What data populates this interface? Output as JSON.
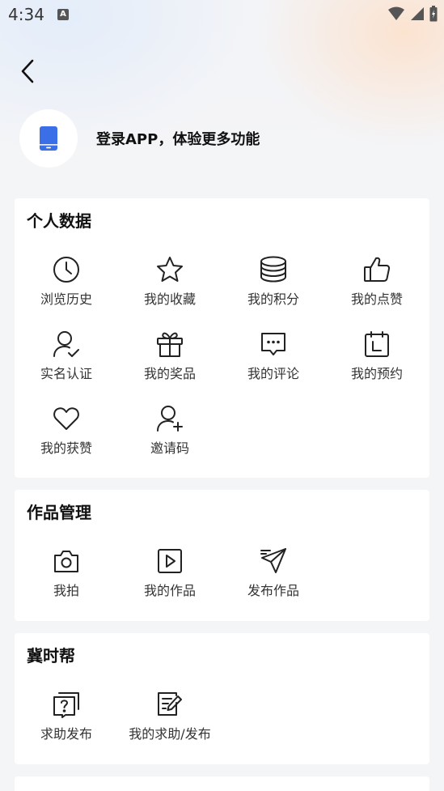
{
  "status_bar": {
    "time": "4:34",
    "notice_badge": "A"
  },
  "login": {
    "text": "登录APP，体验更多功能"
  },
  "sections": [
    {
      "title": "个人数据",
      "items": [
        {
          "label": "浏览历史",
          "icon": "clock-icon"
        },
        {
          "label": "我的收藏",
          "icon": "star-icon"
        },
        {
          "label": "我的积分",
          "icon": "coins-icon"
        },
        {
          "label": "我的点赞",
          "icon": "thumbs-up-icon"
        },
        {
          "label": "实名认证",
          "icon": "user-check-icon"
        },
        {
          "label": "我的奖品",
          "icon": "gift-icon"
        },
        {
          "label": "我的评论",
          "icon": "comment-icon"
        },
        {
          "label": "我的预约",
          "icon": "calendar-icon"
        },
        {
          "label": "我的获赞",
          "icon": "heart-icon"
        },
        {
          "label": "邀请码",
          "icon": "user-plus-icon"
        }
      ]
    },
    {
      "title": "作品管理",
      "items": [
        {
          "label": "我拍",
          "icon": "camera-icon"
        },
        {
          "label": "我的作品",
          "icon": "play-box-icon"
        },
        {
          "label": "发布作品",
          "icon": "send-icon"
        }
      ]
    },
    {
      "title": "冀时帮",
      "items": [
        {
          "label": "求助发布",
          "icon": "question-icon"
        },
        {
          "label": "我的求助/发布",
          "icon": "edit-doc-icon"
        }
      ]
    }
  ],
  "colors": {
    "accent": "#3b6fe8",
    "text": "#111111",
    "label": "#333333"
  }
}
